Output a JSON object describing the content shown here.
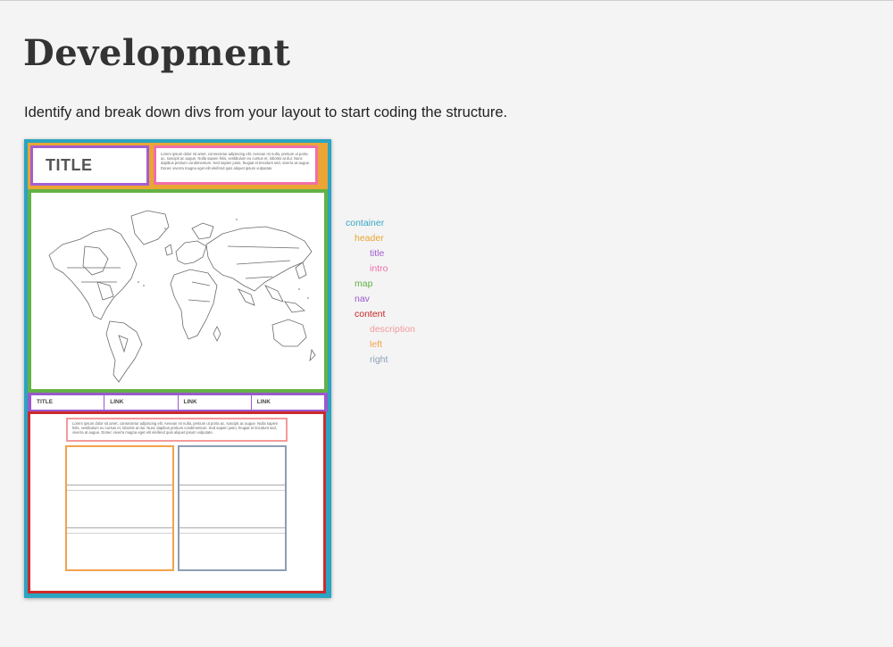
{
  "page": {
    "title": "Development",
    "subtitle": "Identify and break down divs from your layout to start coding the structure."
  },
  "wireframe": {
    "title_text": "TITLE",
    "intro_lorem": "Lorem ipsum dolor sit amet, consectetur adipiscing elit. Aenean mi nulla, pretium ut porta ac, suscipit ac augue. Nulla sapien felis, vestibulum eu cursus et, lobortis at dui. Nunc dapibus pretium condimentum. Sed sapien justo, feugiat et tincidunt sed, viverra at augue. Donec viverra magna eget elit eleifend quis aliquet ipsum vulputate.",
    "nav": [
      "TITLE",
      "LINK",
      "LINK",
      "LINK"
    ],
    "description_lorem": "Lorem ipsum dolor sit amet, consectetur adipiscing elit. Aenean mi nulla, pretium ut porta ac, suscipit ac augue. Nulla sapien felis, vestibulum eu cursus et, lobortis at dui. Nunc dapibus pretium condimentum. Sed sapien justo, feugiat et tincidunt sed, viverra at augue. Donec viverra magna eget elit eleifend quis aliquet ipsum vulputate."
  },
  "legend": [
    {
      "label": "container",
      "color": "#3aa6c6"
    },
    {
      "label": "header",
      "color": "#eaa534"
    },
    {
      "label": "title",
      "color": "#a35ed1"
    },
    {
      "label": "intro",
      "color": "#f16fa9"
    },
    {
      "label": "map",
      "color": "#63b246"
    },
    {
      "label": "nav",
      "color": "#9a58cf"
    },
    {
      "label": "content",
      "color": "#c62828"
    },
    {
      "label": "description",
      "color": "#f39a9a"
    },
    {
      "label": "left",
      "color": "#f3a24c"
    },
    {
      "label": "right",
      "color": "#8ca0b8"
    }
  ]
}
